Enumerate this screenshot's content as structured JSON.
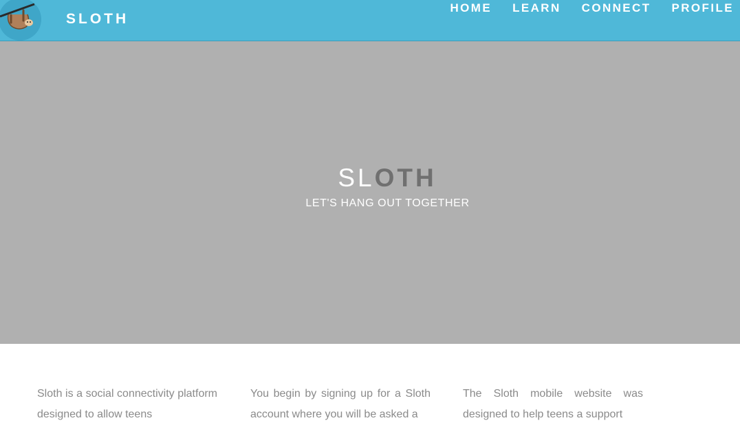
{
  "header": {
    "brand": "SLOTH",
    "logo_icon": "sloth-logo-icon",
    "nav": [
      {
        "label": "HOME"
      },
      {
        "label": "LEARN"
      },
      {
        "label": "CONNECT"
      },
      {
        "label": "PROFILE"
      }
    ],
    "background_color": "#4fb8d8"
  },
  "hero": {
    "title_part1": "SL",
    "title_part2": "OTH",
    "subtitle": "LET'S HANG OUT TOGETHER",
    "background_color": "#b0b0b0"
  },
  "content": {
    "columns": [
      {
        "text": "Sloth is a social connectivity platform designed to allow teens"
      },
      {
        "text": "You begin by signing up for a Sloth account where you will be asked a"
      },
      {
        "text": "The Sloth mobile website was designed to help teens a support"
      }
    ]
  }
}
